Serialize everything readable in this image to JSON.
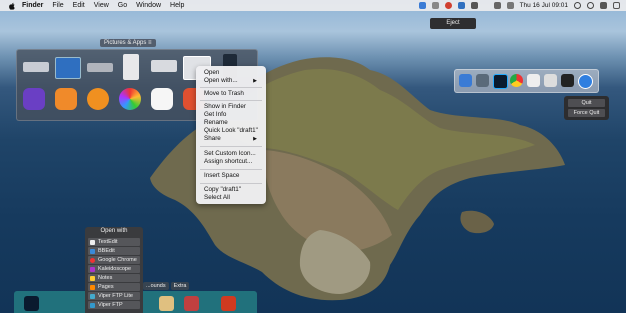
{
  "menubar": {
    "app_name": "Finder",
    "menus": [
      "File",
      "Edit",
      "View",
      "Go",
      "Window",
      "Help"
    ],
    "clock": "Thu 16 Jul  09:01",
    "eject_tooltip": "Eject"
  },
  "pictures_panel": {
    "title": "Pictures & Apps"
  },
  "context_menu": {
    "items": [
      "Open",
      "Open with...",
      "Move to Trash",
      "Show in Finder",
      "Get Info",
      "Rename",
      "Quick Look \"draft1\"",
      "Share",
      "Set Custom Icon...",
      "Assign shortcut...",
      "Insert Space",
      "Copy \"draft1\"",
      "Select All"
    ]
  },
  "quit_menu": {
    "quit": "Quit",
    "force_quit": "Force Quit"
  },
  "open_with": {
    "title": "Open with",
    "apps": [
      "TextEdit",
      "BBEdit",
      "Google Chrome",
      "Kaleidoscope",
      "Notes",
      "Pages",
      "Viper FTP Lite",
      "Viper FTP"
    ]
  },
  "bottom_tabs": [
    "...ounds",
    "Extra"
  ],
  "colors": {
    "accent": "#2f7fe0",
    "menu_bg": "#f0f0f2",
    "panel_bg": "#46505c"
  }
}
